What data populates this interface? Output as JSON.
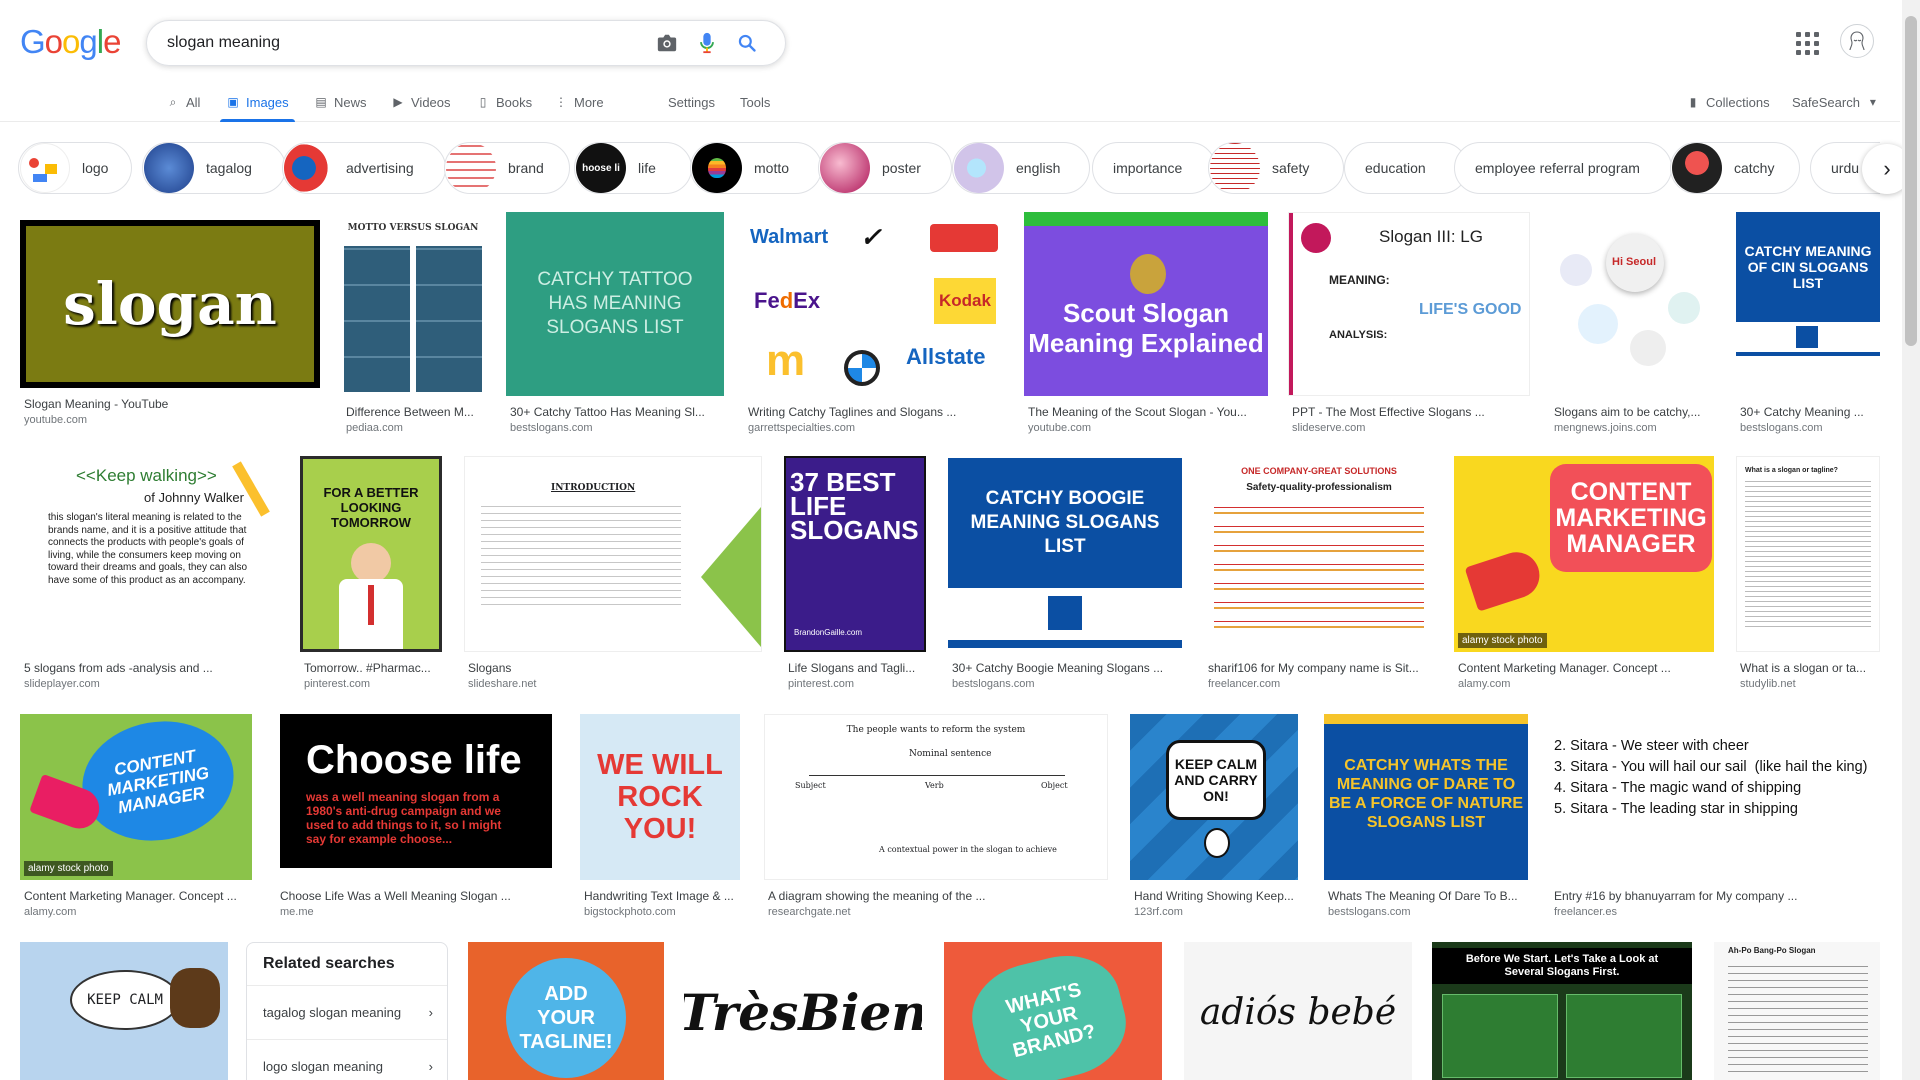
{
  "logo": [
    "G",
    "o",
    "o",
    "g",
    "l",
    "e"
  ],
  "search": {
    "query": "slogan meaning"
  },
  "tabs": [
    {
      "label": "All",
      "icon": "search-icon"
    },
    {
      "label": "Images",
      "icon": "image-icon"
    },
    {
      "label": "News",
      "icon": "news-icon"
    },
    {
      "label": "Videos",
      "icon": "video-icon"
    },
    {
      "label": "Books",
      "icon": "book-icon"
    },
    {
      "label": "More",
      "icon": "more-vert-icon"
    },
    {
      "label": "Settings"
    },
    {
      "label": "Tools"
    }
  ],
  "right_tools": {
    "collections": "Collections",
    "safesearch": "SafeSearch"
  },
  "chips": [
    "logo",
    "tagalog",
    "advertising",
    "brand",
    "life",
    "motto",
    "poster",
    "english",
    "importance",
    "safety",
    "education",
    "employee referral program",
    "catchy",
    "urdu"
  ],
  "results": [
    {
      "caption": "Slogan Meaning - YouTube",
      "source": "youtube.com",
      "text": "slogan"
    },
    {
      "caption": "Difference Between M...",
      "source": "pediaa.com",
      "text": "MOTTO VERSUS SLOGAN"
    },
    {
      "caption": "30+ Catchy Tattoo Has Meaning Sl...",
      "source": "bestslogans.com",
      "text": "CATCHY TATTOO HAS MEANING SLOGANS LIST"
    },
    {
      "caption": "Writing Catchy Taglines and Slogans ...",
      "source": "garrettspecialties.com",
      "text": "Walmart"
    },
    {
      "caption": "The Meaning of the Scout Slogan - You...",
      "source": "youtube.com",
      "text": "Scout Slogan Meaning Explained"
    },
    {
      "caption": "PPT - The Most Effective Slogans ...",
      "source": "slideserve.com",
      "text": "Slogan III: LG"
    },
    {
      "caption": "Slogans aim to be catchy,...",
      "source": "mengnews.joins.com",
      "text": "Hi Seoul"
    },
    {
      "caption": "30+ Catchy Meaning ...",
      "source": "bestslogans.com",
      "text": "CATCHY MEANING OF CIN SLOGANS LIST"
    },
    {
      "caption": "5 slogans from ads -analysis and ...",
      "source": "slideplayer.com",
      "text": "<<Keep walking>>"
    },
    {
      "caption": "Tomorrow.. #Pharmac...",
      "source": "pinterest.com",
      "text": "FOR A BETTER LOOKING TOMORROW"
    },
    {
      "caption": "Slogans",
      "source": "slideshare.net",
      "text": "INTRODUCTION"
    },
    {
      "caption": "Life Slogans and Tagli...",
      "source": "pinterest.com",
      "text": "37 BEST LIFE SLOGANS"
    },
    {
      "caption": "30+ Catchy Boogie Meaning Slogans ...",
      "source": "bestslogans.com",
      "text": "CATCHY BOOGIE MEANING SLOGANS LIST"
    },
    {
      "caption": "sharif106 for My company name is Sit...",
      "source": "freelancer.com",
      "text": "ONE COMPANY-GREAT SOLUTIONS"
    },
    {
      "caption": "Content Marketing Manager. Concept ...",
      "source": "alamy.com",
      "text": "CONTENT MARKETING MANAGER"
    },
    {
      "caption": "What is a slogan or ta...",
      "source": "studylib.net",
      "text": "What is a slogan or tagline?"
    },
    {
      "caption": "Content Marketing Manager. Concept ...",
      "source": "alamy.com",
      "text": "CONTENT MARKETING MANAGER"
    },
    {
      "caption": "Choose Life Was a Well Meaning Slogan ...",
      "source": "me.me",
      "text": "Choose life"
    },
    {
      "caption": "Handwriting Text Image & ...",
      "source": "bigstockphoto.com",
      "text": "WE WILL ROCK YOU!"
    },
    {
      "caption": "A diagram showing the meaning of the ...",
      "source": "researchgate.net",
      "text": "The people wants to reform the system"
    },
    {
      "caption": "Hand Writing Showing Keep...",
      "source": "123rf.com",
      "text": "KEEP CALM AND CARRY ON!"
    },
    {
      "caption": "Whats The Meaning Of Dare To B...",
      "source": "bestslogans.com",
      "text": "CATCHY WHATS THE MEANING OF DARE TO BE A FORCE OF NATURE SLOGANS LIST"
    },
    {
      "caption": "Entry #16 by bhanuyarram for My company ...",
      "source": "freelancer.es",
      "text": "2. Sitara - We steer with cheer"
    }
  ],
  "row4": [
    "KEEP CALM",
    "ADD YOUR TAGLINE!",
    "TrèsBien",
    "WHAT'S YOUR BRAND?",
    "adiós bebé",
    "Before We Start. Let's Take a Look at Several Slogans First.",
    "Ah-Po Bang-Po Slogan"
  ],
  "related": {
    "title": "Related searches",
    "items": [
      "tagalog slogan meaning",
      "logo slogan meaning"
    ]
  }
}
